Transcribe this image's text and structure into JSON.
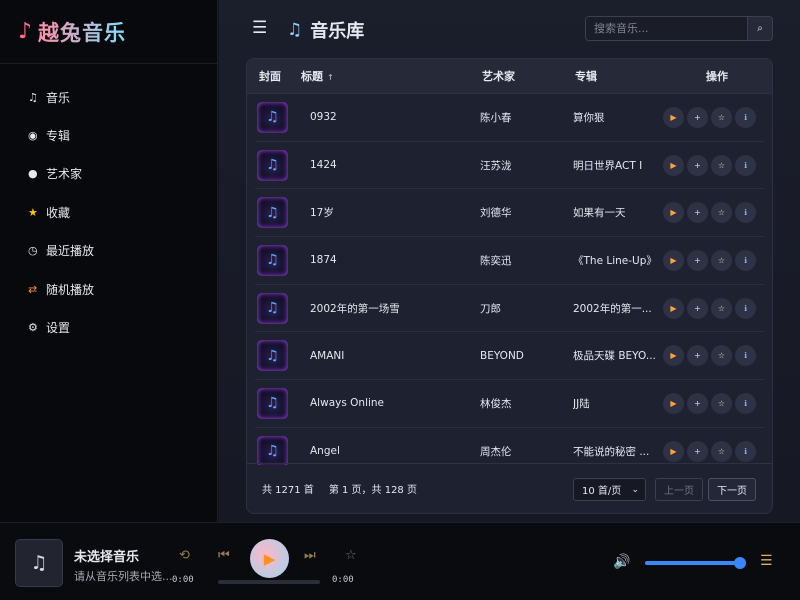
{
  "app": {
    "logo_icon": "♪",
    "name": "越兔音乐"
  },
  "sidebar": {
    "items": [
      {
        "icon": "♫",
        "label": "音乐"
      },
      {
        "icon": "◉",
        "label": "专辑"
      },
      {
        "icon": "●",
        "label": "艺术家"
      },
      {
        "icon": "★",
        "label": "收藏"
      },
      {
        "icon": "◷",
        "label": "最近播放"
      },
      {
        "icon": "⇄",
        "label": "随机播放"
      },
      {
        "icon": "⚙",
        "label": "设置"
      }
    ]
  },
  "header": {
    "menu_icon": "☰",
    "title_icon": "♫",
    "title": "音乐库",
    "search_placeholder": "搜索音乐...",
    "search_icon": "⌕"
  },
  "table": {
    "columns": {
      "cover": "封面",
      "title": "标题",
      "sort_indicator": "↑",
      "artist": "艺术家",
      "album": "专辑",
      "ops": "操作"
    },
    "rows": [
      {
        "title": "0932",
        "artist": "陈小春",
        "album": "算你狠"
      },
      {
        "title": "1424",
        "artist": "汪苏泷",
        "album": "明日世界ACT I"
      },
      {
        "title": "17岁",
        "artist": "刘德华",
        "album": "如果有一天"
      },
      {
        "title": "1874",
        "artist": "陈奕迅",
        "album": "《The Line-Up》"
      },
      {
        "title": "2002年的第一场雪",
        "artist": "刀郎",
        "album": "2002年的第一..."
      },
      {
        "title": "AMANI",
        "artist": "BEYOND",
        "album": "极品天碟 BEYO..."
      },
      {
        "title": "Always Online",
        "artist": "林俊杰",
        "album": "JJ陆"
      },
      {
        "title": "Angel",
        "artist": "周杰伦",
        "album": "不能说的秘密 ..."
      }
    ],
    "op_icons": {
      "play": "▶",
      "add": "+",
      "fav": "☆",
      "info": "ℹ"
    }
  },
  "pager": {
    "total": "共 1271 首",
    "page_info": "第 1 页，共 128 页",
    "page_size": "10 首/页",
    "prev": "上一页",
    "next": "下一页"
  },
  "player": {
    "cover_icon": "♫",
    "title": "未选择音乐",
    "subtitle": "请从音乐列表中选...",
    "time_current": "0:00",
    "time_total": "0:00",
    "progress_fraction": 0,
    "volume_fraction": 1,
    "icons": {
      "repeat": "⟲",
      "prev": "⏮",
      "play": "▶",
      "next": "⏭",
      "fav": "☆",
      "volume": "🔊",
      "playlist": "☰"
    }
  },
  "colors": {
    "accent": "#3a86ff",
    "play_orange": "#f7931e"
  }
}
